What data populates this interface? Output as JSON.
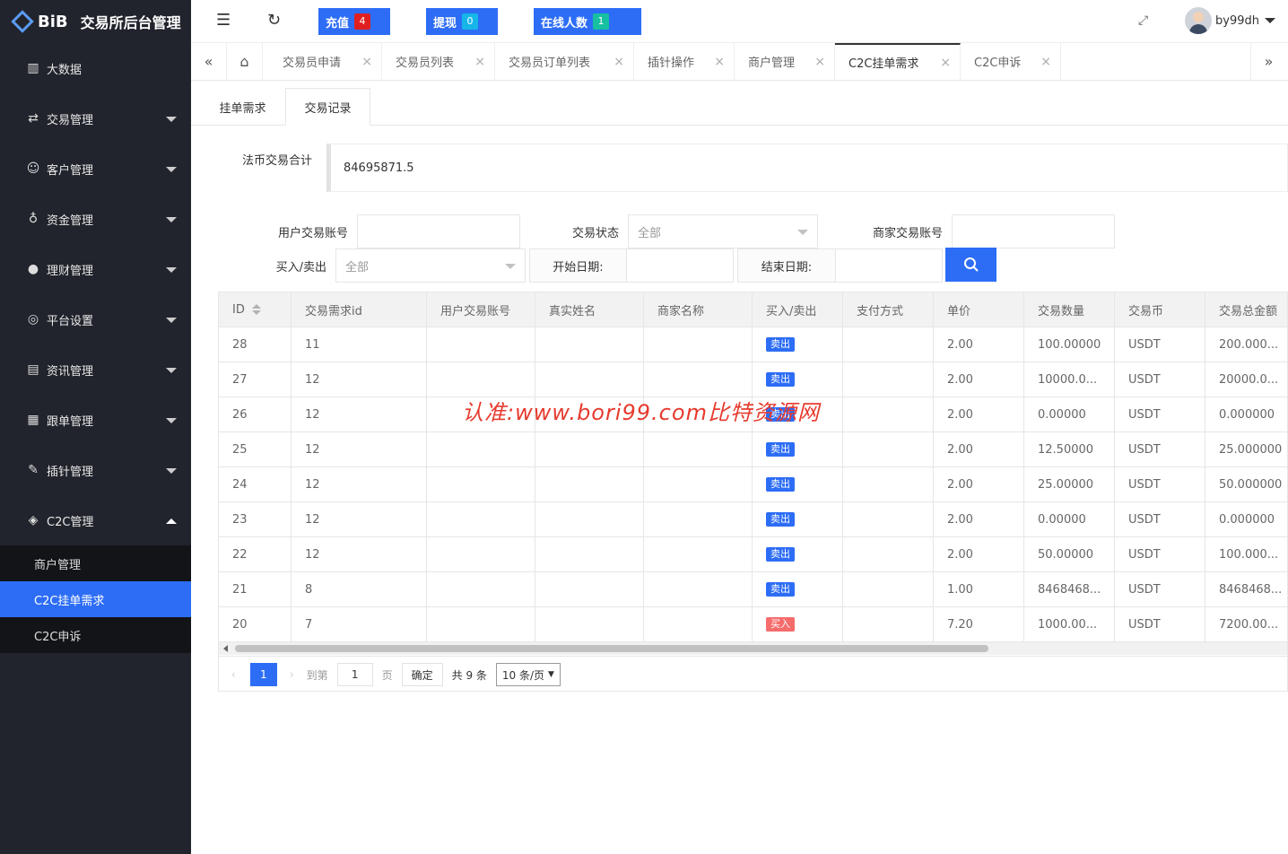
{
  "app": {
    "logo_text": "BiB",
    "title": "交易所后台管理"
  },
  "sidebar": {
    "items": [
      {
        "label": "大数据",
        "icon": "bar-chart-icon"
      },
      {
        "label": "交易管理",
        "icon": "transfer-icon"
      },
      {
        "label": "客户管理",
        "icon": "users-icon"
      },
      {
        "label": "资金管理",
        "icon": "money-bag-icon"
      },
      {
        "label": "理财管理",
        "icon": "piggy-bank-icon"
      },
      {
        "label": "平台设置",
        "icon": "settings-circle-icon"
      },
      {
        "label": "资讯管理",
        "icon": "news-icon"
      },
      {
        "label": "跟单管理",
        "icon": "document-icon"
      },
      {
        "label": "插针管理",
        "icon": "needle-icon"
      },
      {
        "label": "C2C管理",
        "icon": "c2c-icon"
      }
    ],
    "submenu": [
      {
        "label": "商户管理"
      },
      {
        "label": "C2C挂单需求"
      },
      {
        "label": "C2C申诉"
      }
    ]
  },
  "topbar": {
    "recharge": {
      "label": "充值",
      "count": "4"
    },
    "withdraw": {
      "label": "提现",
      "count": "0"
    },
    "online": {
      "label": "在线人数",
      "count": "1"
    },
    "username": "by99dh"
  },
  "tabs": [
    {
      "label": "交易员申请"
    },
    {
      "label": "交易员列表"
    },
    {
      "label": "交易员订单列表"
    },
    {
      "label": "插针操作"
    },
    {
      "label": "商户管理"
    },
    {
      "label": "C2C挂单需求"
    },
    {
      "label": "C2C申诉"
    }
  ],
  "subtabs": [
    {
      "label": "挂单需求"
    },
    {
      "label": "交易记录"
    }
  ],
  "summary": {
    "label": "法币交易合计",
    "value": "84695871.5"
  },
  "filters": {
    "user_account": "用户交易账号",
    "status": "交易状态",
    "status_value": "全部",
    "merchant_account": "商家交易账号",
    "direction": "买入/卖出",
    "direction_value": "全部",
    "start_date": "开始日期:",
    "end_date": "结束日期:"
  },
  "table": {
    "headers": [
      "ID",
      "交易需求id",
      "用户交易账号",
      "真实姓名",
      "商家名称",
      "买入/卖出",
      "支付方式",
      "单价",
      "交易数量",
      "交易币",
      "交易总金额"
    ],
    "rows": [
      [
        "28",
        "11",
        "",
        "",
        "",
        "卖出",
        "",
        "2.00",
        "100.00000",
        "USDT",
        "200.000..."
      ],
      [
        "27",
        "12",
        "",
        "",
        "",
        "卖出",
        "",
        "2.00",
        "10000.0...",
        "USDT",
        "20000.0..."
      ],
      [
        "26",
        "12",
        "",
        "",
        "",
        "卖出",
        "",
        "2.00",
        "0.00000",
        "USDT",
        "0.000000"
      ],
      [
        "25",
        "12",
        "",
        "",
        "",
        "卖出",
        "",
        "2.00",
        "12.50000",
        "USDT",
        "25.000000"
      ],
      [
        "24",
        "12",
        "",
        "",
        "",
        "卖出",
        "",
        "2.00",
        "25.00000",
        "USDT",
        "50.000000"
      ],
      [
        "23",
        "12",
        "",
        "",
        "",
        "卖出",
        "",
        "2.00",
        "0.00000",
        "USDT",
        "0.000000"
      ],
      [
        "22",
        "12",
        "",
        "",
        "",
        "卖出",
        "",
        "2.00",
        "50.00000",
        "USDT",
        "100.000..."
      ],
      [
        "21",
        "8",
        "",
        "",
        "",
        "卖出",
        "",
        "1.00",
        "8468468...",
        "USDT",
        "8468468..."
      ],
      [
        "20",
        "7",
        "",
        "",
        "",
        "买入",
        "",
        "7.20",
        "1000.00...",
        "USDT",
        "7200.00..."
      ]
    ]
  },
  "pagination": {
    "current": "1",
    "goto_label": "到第",
    "goto_value": "1",
    "page_unit": "页",
    "confirm": "确定",
    "total": "共 9 条",
    "page_size": "10 条/页"
  },
  "watermark": "认准:www.bori99.com比特资源网",
  "colors": {
    "accent": "#2d6df6",
    "sidebar_bg": "#21242c",
    "sell": "#2d6df6",
    "buy": "#f56c6c"
  }
}
